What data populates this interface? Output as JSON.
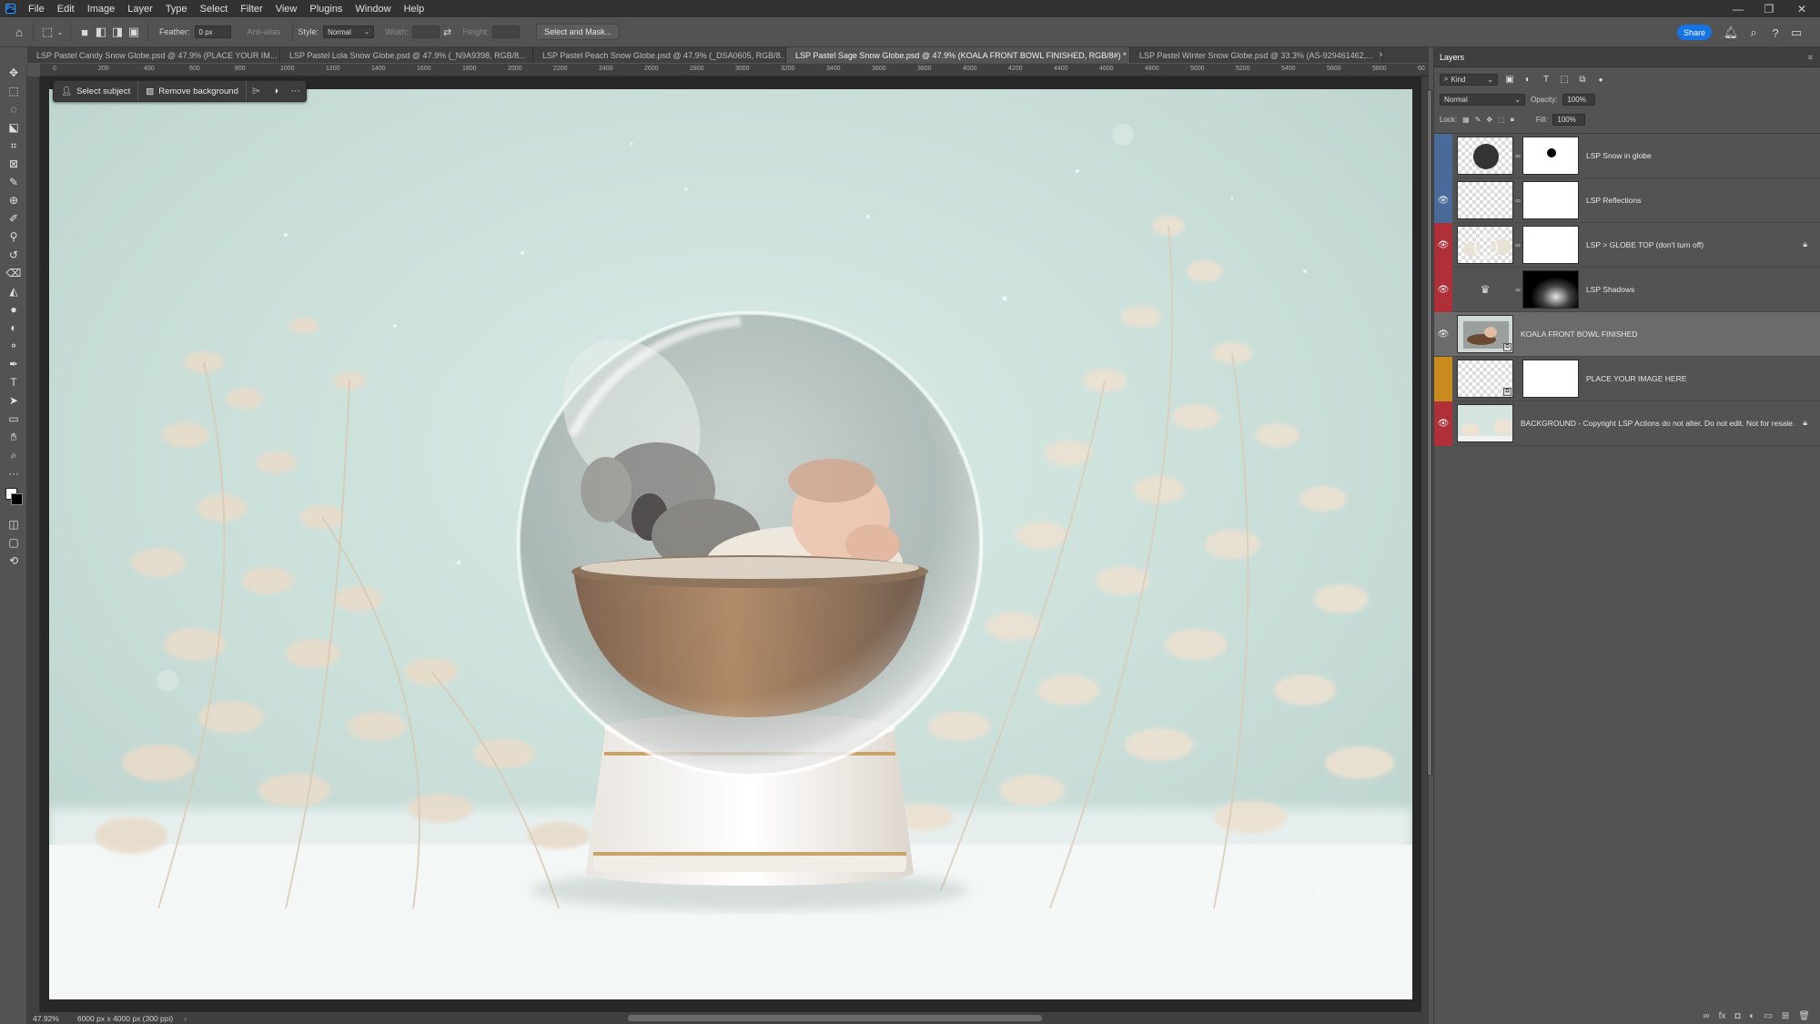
{
  "menu": {
    "items": [
      "File",
      "Edit",
      "Image",
      "Layer",
      "Type",
      "Select",
      "Filter",
      "View",
      "Plugins",
      "Window",
      "Help"
    ]
  },
  "options": {
    "feather_label": "Feather:",
    "feather_value": "0 px",
    "antialias_label": "Anti-alias",
    "style_label": "Style:",
    "style_value": "Normal",
    "width_label": "Width:",
    "height_label": "Height:",
    "select_mask": "Select and Mask...",
    "share": "Share"
  },
  "tabs": [
    {
      "label": "LSP Pastel Candy Snow Globe.psd @ 47.9% (PLACE YOUR IM...",
      "active": false
    },
    {
      "label": "LSP Pastel Lola Snow Globe.psd @ 47.9% (_N9A9398, RGB/8...",
      "active": false
    },
    {
      "label": "LSP Pastel Peach Snow Globe.psd @ 47.9% (_DSA0605, RGB/8...",
      "active": false
    },
    {
      "label": "LSP Pastel Sage Snow Globe.psd @ 47.9% (KOALA FRONT BOWL FINISHED, RGB/8#) *",
      "active": true
    },
    {
      "label": "LSP Pastel Winter Snow Globe.psd @ 33.3% (AS-929461462,...",
      "active": false
    }
  ],
  "ruler_ticks": [
    "0",
    "200",
    "400",
    "600",
    "800",
    "1000",
    "1200",
    "1400",
    "1600",
    "1800",
    "2000",
    "2200",
    "2400",
    "2600",
    "2800",
    "3000",
    "3200",
    "3400",
    "3600",
    "3800",
    "4000",
    "4200",
    "4400",
    "4600",
    "4800",
    "5000",
    "5200",
    "5400",
    "5600",
    "5800",
    "60"
  ],
  "context_bar": {
    "select_subject": "Select subject",
    "remove_background": "Remove background"
  },
  "status": {
    "zoom": "47.92%",
    "doc_info": "6000 px x 4000 px (300 ppi)"
  },
  "layers_panel": {
    "title": "Layers",
    "kind": "Kind",
    "blend_mode": "Normal",
    "opacity_label": "Opacity:",
    "opacity_value": "100%",
    "lock_label": "Lock:",
    "fill_label": "Fill:",
    "fill_value": "100%",
    "layers": [
      {
        "name": "LSP Snow in globe",
        "color": "#4a6a9a",
        "visible": false,
        "selected": false,
        "locked": false
      },
      {
        "name": "LSP Reflections",
        "color": "#4a6a9a",
        "visible": true,
        "selected": false,
        "locked": false
      },
      {
        "name": "LSP > GLOBE TOP (don't turn off)",
        "color": "#b0303a",
        "visible": true,
        "selected": false,
        "locked": true
      },
      {
        "name": "LSP Shadows",
        "color": "#b0303a",
        "visible": true,
        "selected": false,
        "locked": false
      },
      {
        "name": "KOALA FRONT BOWL FINISHED",
        "color": "",
        "visible": true,
        "selected": true,
        "locked": false
      },
      {
        "name": "PLACE YOUR IMAGE HERE",
        "color": "#c98a1e",
        "visible": false,
        "selected": false,
        "locked": false
      },
      {
        "name": "BACKGROUND - Copyright LSP Actions do not alter. Do not edit. Not for resale.",
        "color": "#b0303a",
        "visible": true,
        "selected": false,
        "locked": true
      }
    ]
  }
}
